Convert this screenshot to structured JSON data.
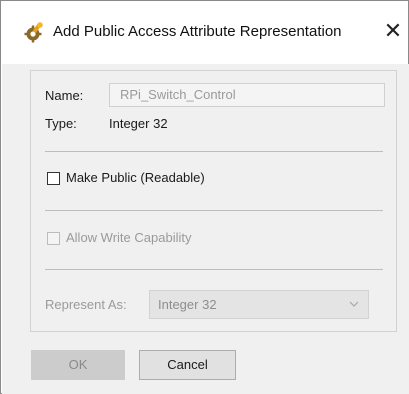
{
  "dialog": {
    "title": "Add Public Access Attribute Representation",
    "close_glyph": "✕",
    "icon": "gear-wrench-icon"
  },
  "form": {
    "name_label": "Name:",
    "name_value": "RPi_Switch_Control",
    "type_label": "Type:",
    "type_value": "Integer 32",
    "make_public_label": "Make Public (Readable)",
    "make_public_checked": false,
    "allow_write_label": "Allow Write Capability",
    "allow_write_checked": false,
    "allow_write_enabled": false,
    "represent_as_label": "Represent As:",
    "represent_as_value": "Integer 32",
    "represent_as_enabled": false
  },
  "buttons": {
    "ok_label": "OK",
    "ok_enabled": false,
    "cancel_label": "Cancel"
  }
}
